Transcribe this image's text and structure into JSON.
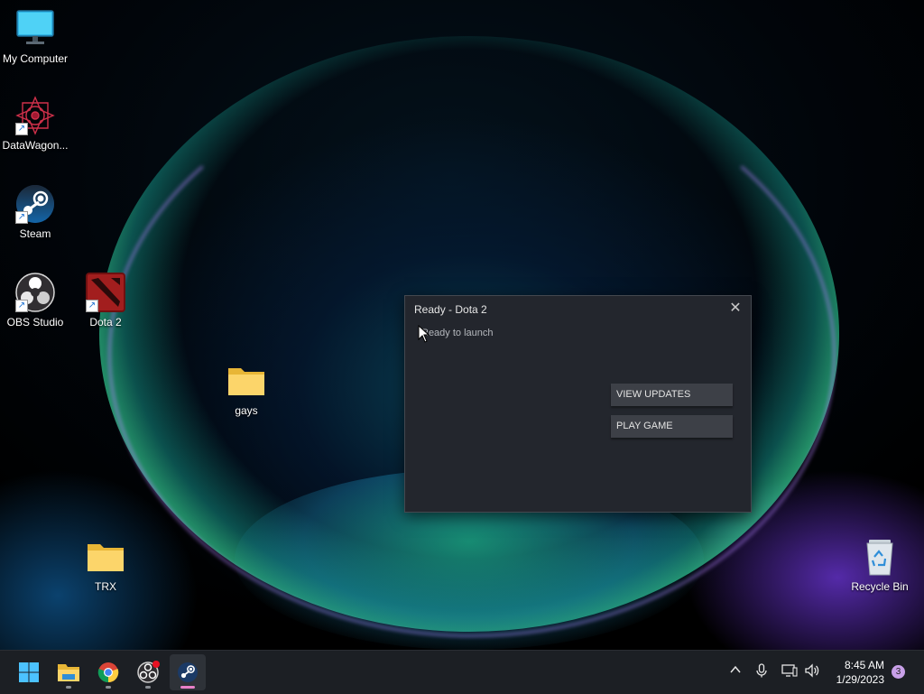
{
  "desktop_icons": [
    {
      "label": "My Computer",
      "icon": "monitor-icon"
    },
    {
      "label": "DataWagon...",
      "icon": "datawagon-icon"
    },
    {
      "label": "Steam",
      "icon": "steam-icon"
    },
    {
      "label": "OBS Studio",
      "icon": "obs-icon"
    },
    {
      "label": "Dota 2",
      "icon": "dota2-icon"
    },
    {
      "label": "gays",
      "icon": "folder-icon"
    },
    {
      "label": "TRX",
      "icon": "folder-icon"
    },
    {
      "label": "Recycle Bin",
      "icon": "recycle-bin-icon"
    }
  ],
  "dialog": {
    "title": "Ready - Dota 2",
    "status": "Ready to launch",
    "view_updates_label": "VIEW UPDATES",
    "play_game_label": "PLAY GAME",
    "close_glyph": "✕"
  },
  "taskbar": {
    "apps": [
      "start-icon",
      "file-explorer-icon",
      "chrome-icon",
      "obs-icon",
      "steam-icon"
    ],
    "tray_icons": [
      "chevron-up-icon",
      "microphone-icon",
      "network-icon",
      "speaker-icon"
    ],
    "time": "8:45 AM",
    "date": "1/29/2023",
    "notification_count": "3"
  },
  "colors": {
    "dialog_bg": "#23262d",
    "button_bg": "#3d4047",
    "taskbar_bg": "#1c1f24",
    "active_indicator": "#e880c8"
  }
}
